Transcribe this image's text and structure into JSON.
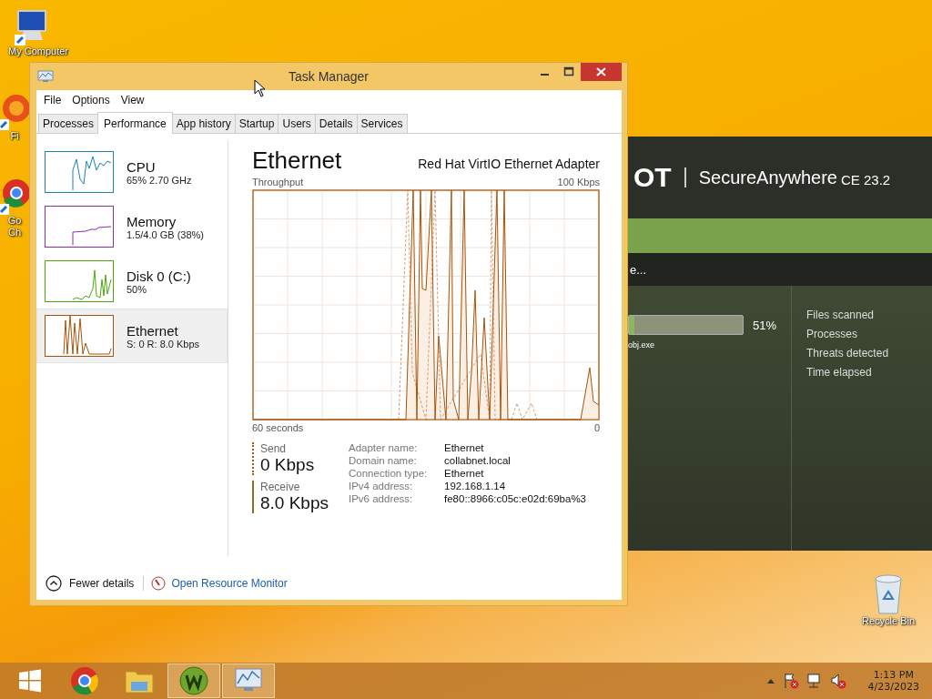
{
  "desktop_icons": [
    {
      "label": "My Computer",
      "kind": "computer"
    },
    {
      "label": "Fi",
      "kind": "firefox"
    },
    {
      "label": "Go Ch",
      "kind": "chrome"
    }
  ],
  "background_app": {
    "logo": "OT",
    "title": "SecureAnywhere",
    "version": "CE 23.2",
    "status": "e...",
    "progress": {
      "level": 0.05,
      "reading": "51%"
    },
    "file": "obj.exe",
    "stats": [
      "Files scanned",
      "Processes",
      "Threats detected",
      "Time elapsed"
    ]
  },
  "window": {
    "title": "Task Manager"
  },
  "menu": [
    "File",
    "Options",
    "View"
  ],
  "tabs": [
    {
      "label": "Processes",
      "selected": false
    },
    {
      "label": "Performance",
      "selected": true
    },
    {
      "label": "App history",
      "selected": false
    },
    {
      "label": "Startup",
      "selected": false
    },
    {
      "label": "Users",
      "selected": false
    },
    {
      "label": "Details",
      "selected": false
    },
    {
      "label": "Services",
      "selected": false
    }
  ],
  "sidebar": {
    "items": [
      {
        "name": "CPU",
        "detail": "65% 2.70 GHz",
        "color": "#1c7fb8",
        "selected": false
      },
      {
        "name": "Memory",
        "detail": "1.5/4.0 GB (38%)",
        "color": "#8b2fa8",
        "selected": false
      },
      {
        "name": "Disk 0 (C:)",
        "detail": "50%",
        "color": "#4da60c",
        "selected": false
      },
      {
        "name": "Ethernet",
        "detail": "S: 0 R: 8.0 Kbps",
        "color": "#a7530c",
        "selected": true
      }
    ]
  },
  "detail": {
    "title": "Ethernet",
    "adapter": "Red Hat VirtIO Ethernet Adapter",
    "graph_label": "Throughput",
    "graph_max": "100 Kbps",
    "graph_time": "60 seconds",
    "graph_min": "0",
    "send": {
      "label": "Send",
      "value": "0 Kbps"
    },
    "receive": {
      "label": "Receive",
      "value": "8.0 Kbps"
    },
    "properties": [
      {
        "label": "Adapter name:",
        "value": "Ethernet"
      },
      {
        "label": "Domain name:",
        "value": "collabnet.local"
      },
      {
        "label": "Connection type:",
        "value": "Ethernet"
      },
      {
        "label": "IPv4 address:",
        "value": "192.168.1.14"
      },
      {
        "label": "IPv6 address:",
        "value": "fe80::8966:c05c:e02d:69ba%3"
      }
    ]
  },
  "footer": {
    "fewer_details": "Fewer details",
    "resource_monitor": "Open Resource Monitor"
  },
  "recycle_bin": {
    "label": "Recycle Bin"
  },
  "taskbar": {
    "apps": [
      {
        "kind": "start",
        "active": false
      },
      {
        "kind": "chrome",
        "active": false
      },
      {
        "kind": "explorer",
        "active": false
      },
      {
        "kind": "webroot",
        "active": true
      },
      {
        "kind": "taskmanager",
        "active": true
      }
    ],
    "time": "1:13 PM",
    "date": "4/23/2023"
  }
}
